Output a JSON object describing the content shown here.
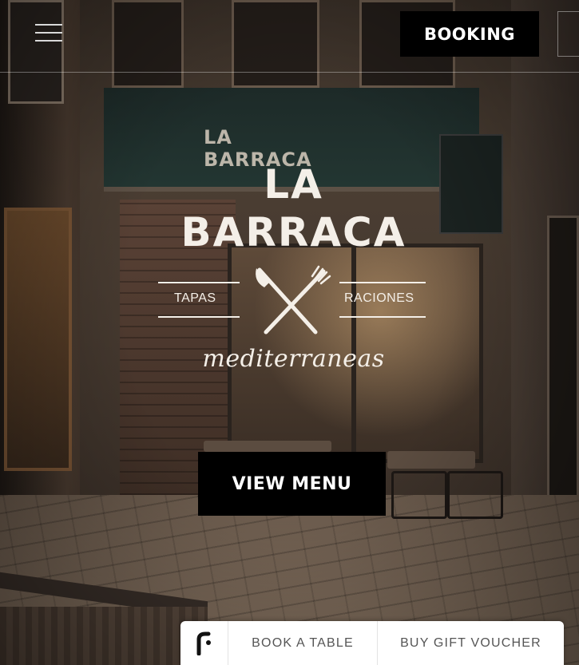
{
  "header": {
    "menu_icon": "hamburger-menu-icon",
    "booking_label": "BOOKING"
  },
  "hero": {
    "logo": {
      "line1": "LA",
      "line2": "BARRACA",
      "left_tag": "TAPAS",
      "right_tag": "RACIONES",
      "emblem_icon": "knife-fork-cross-icon",
      "script": "mediterraneas"
    },
    "view_menu_label": "VIEW MENU"
  },
  "booking_widget": {
    "brand_icon": "reservation-brand-logo-icon",
    "book_table_label": "BOOK A TABLE",
    "gift_voucher_label": "BUY GIFT VOUCHER"
  },
  "colors": {
    "button_bg": "#000000",
    "button_text": "#ffffff",
    "logo_text": "#f4efe8",
    "widget_bg": "#ffffff",
    "widget_text": "#555555"
  }
}
